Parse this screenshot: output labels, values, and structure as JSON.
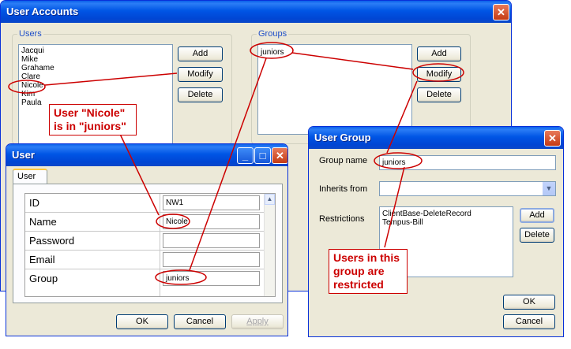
{
  "user_accounts": {
    "title": "User Accounts",
    "users_label": "Users",
    "users": [
      "Jacqui",
      "Mike",
      "Grahame",
      "Clare",
      "Nicole",
      "Kim",
      "Paula"
    ],
    "groups_label": "Groups",
    "groups": [
      "juniors"
    ],
    "add_label": "Add",
    "modify_label": "Modify",
    "delete_label": "Delete"
  },
  "user_window": {
    "title": "User",
    "tab_label": "User",
    "rows": [
      {
        "name": "ID",
        "value": "NW1"
      },
      {
        "name": "Name",
        "value": "Nicole"
      },
      {
        "name": "Password",
        "value": ""
      },
      {
        "name": "Email",
        "value": ""
      },
      {
        "name": "Group",
        "value": "juniors"
      }
    ],
    "ok_label": "OK",
    "cancel_label": "Cancel",
    "apply_label": "Apply"
  },
  "user_group_window": {
    "title": "User Group",
    "group_name_label": "Group name",
    "group_name_value": "juniors",
    "inherits_label": "Inherits from",
    "inherits_value": "",
    "restrictions_label": "Restrictions",
    "restrictions": [
      "ClientBase-DeleteRecord",
      "Tempus-Bill"
    ],
    "add_label": "Add",
    "delete_label": "Delete",
    "ok_label": "OK",
    "cancel_label": "Cancel"
  },
  "annotations": {
    "nicole_callout": [
      "User \"Nicole\"",
      "is in \"juniors\""
    ],
    "restricted_callout": [
      "Users in this",
      "group are",
      "restricted"
    ]
  },
  "colors": {
    "annotation": "#cc0000",
    "title_bar": "#0054e3",
    "window_face": "#ece9d8"
  }
}
